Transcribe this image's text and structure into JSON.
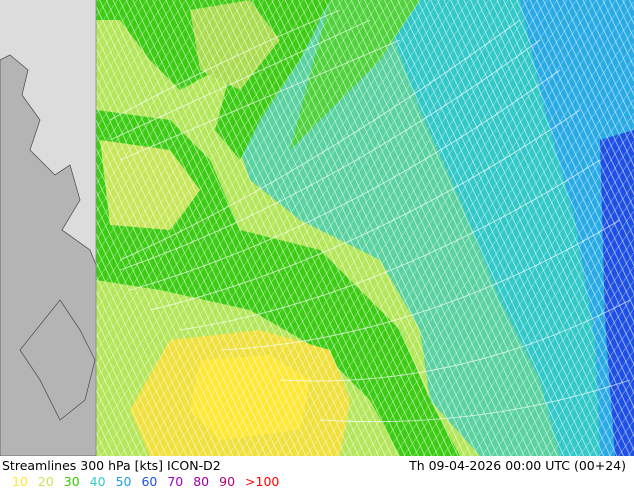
{
  "header": {
    "title_left": "Streamlines 300 hPa [kts] ICON-D2",
    "title_right": "Th 09-04-2026 00:00 UTC (00+24)"
  },
  "legend": [
    {
      "label": "10",
      "color": "#ffe733"
    },
    {
      "label": "20",
      "color": "#c8e65a"
    },
    {
      "label": "30",
      "color": "#33cc00"
    },
    {
      "label": "40",
      "color": "#33cccc"
    },
    {
      "label": "50",
      "color": "#1e9be6"
    },
    {
      "label": "60",
      "color": "#1e50e6"
    },
    {
      "label": "70",
      "color": "#a000c8"
    },
    {
      "label": "80",
      "color": "#a000a0"
    },
    {
      "label": "90",
      "color": "#aa0078"
    },
    {
      "label": ">100",
      "color": "#ff0000"
    }
  ],
  "map": {
    "land_color": "#b4b4b4",
    "sea_color": "#dcdcdc",
    "coast_color": "#555555"
  }
}
